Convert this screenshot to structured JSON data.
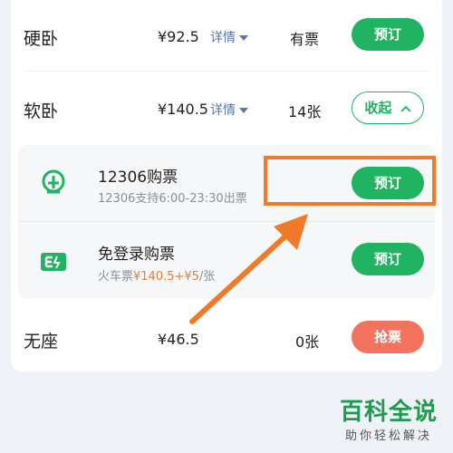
{
  "rows": {
    "hard_sleeper": {
      "name": "硬卧",
      "price": "¥92.5",
      "detail": "详情",
      "availability": "有票",
      "button": "预订"
    },
    "soft_sleeper": {
      "name": "软卧",
      "price": "¥140.5",
      "detail": "详情",
      "availability": "14张",
      "button": "收起"
    },
    "no_seat": {
      "name": "无座",
      "price": "¥46.5",
      "availability": "0张",
      "button": "抢票"
    }
  },
  "booking_options": [
    {
      "title": "12306购票",
      "description": "12306支持6:00-23:30出票",
      "button": "预订"
    },
    {
      "title": "免登录购票",
      "description_prefix": "火车票",
      "description_price": "¥140.5+¥5",
      "description_suffix": "/张",
      "button": "预订"
    }
  ],
  "watermark": {
    "main": "百科全说",
    "sub": "助你轻松解决"
  },
  "colors": {
    "accent_green": "#1fb362",
    "alert_red": "#f3735f",
    "highlight_orange": "#f07a29",
    "link_blue": "#5577aa"
  },
  "icons": [
    "chevron-down-icon",
    "chevron-up-icon",
    "railway-logo-icon",
    "ticket-e-icon",
    "arrow-annotation"
  ]
}
